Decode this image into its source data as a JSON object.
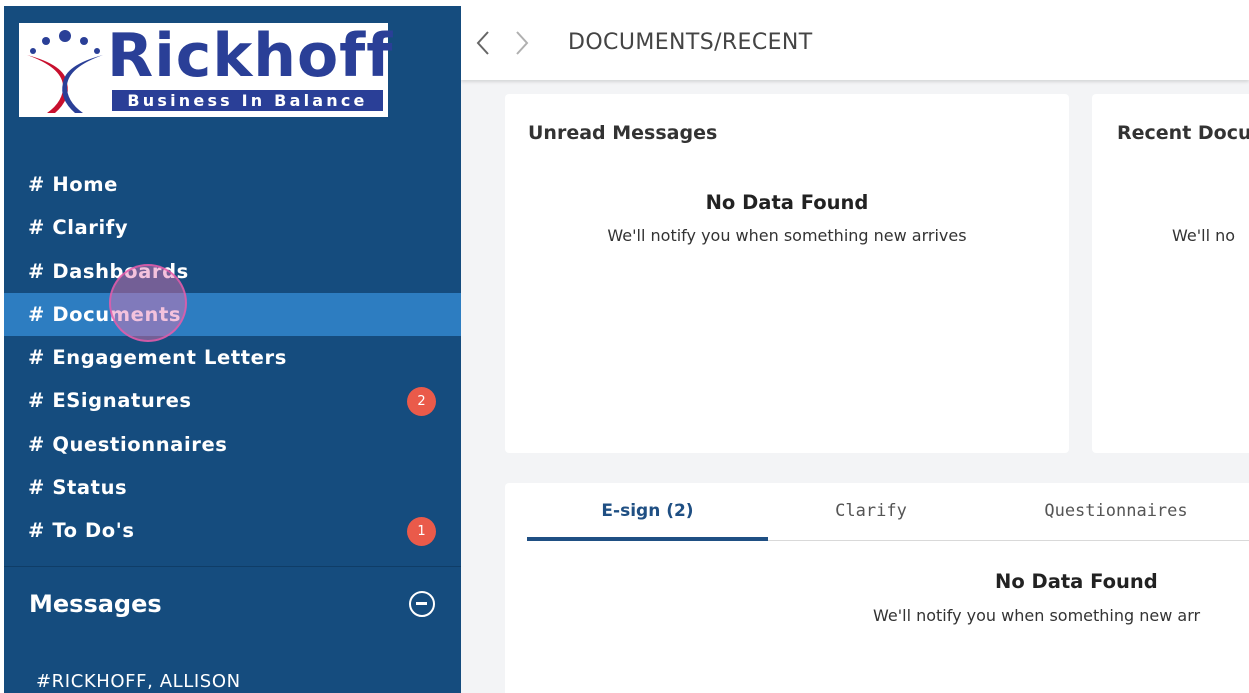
{
  "brand": {
    "name": "Rickhoff",
    "tagline": "Business In Balance",
    "colors": {
      "sidebar": "#154c7e",
      "active": "#2d7dc1",
      "badge": "#ea5a4a",
      "logo": "#2a3f97"
    }
  },
  "sidebar": {
    "items": [
      {
        "label": "# Home"
      },
      {
        "label": "# Clarify"
      },
      {
        "label": "# Dashboards"
      },
      {
        "label": "# Documents",
        "active": true
      },
      {
        "label": "# Engagement Letters"
      },
      {
        "label": "# ESignatures",
        "badge": "2"
      },
      {
        "label": "# Questionnaires"
      },
      {
        "label": "# Status"
      },
      {
        "label": "# To Do's",
        "badge": "1"
      }
    ],
    "messages_title": "Messages",
    "messages_toggle_icon": "minus-circle-icon",
    "contacts": [
      "#RICKHOFF, ALLISON"
    ]
  },
  "topbar": {
    "back_icon": "chevron-left-icon",
    "forward_icon": "chevron-right-icon",
    "breadcrumb": "DOCUMENTS/RECENT"
  },
  "unread_messages": {
    "title": "Unread Messages",
    "empty_title": "No Data Found",
    "empty_text": "We'll notify you when something new arrives"
  },
  "recent_documents": {
    "title": "Recent Docu",
    "empty_text": "We'll no"
  },
  "tasks": {
    "tabs": [
      {
        "label": "E-sign (2)",
        "active": true
      },
      {
        "label": "Clarify"
      },
      {
        "label": "Questionnaires"
      }
    ],
    "empty_title": "No Data Found",
    "empty_text": "We'll notify you when something new arr"
  }
}
